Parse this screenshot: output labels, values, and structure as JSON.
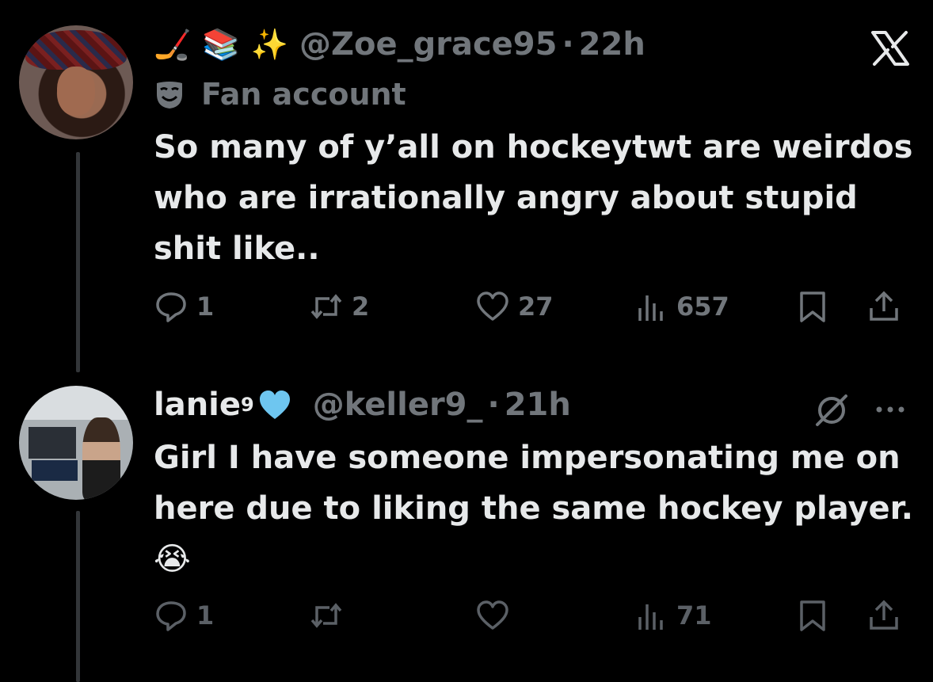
{
  "tweets": [
    {
      "emojis": [
        "🏒",
        "📚",
        "✨"
      ],
      "handle": "@Zoe_grace95",
      "separator": "·",
      "time": "22h",
      "label": "Fan account",
      "text": "So many of y’all on hockeytwt are weirdos who are irrationally angry about stupid shit like..",
      "stats": {
        "replies": "1",
        "reposts": "2",
        "likes": "27",
        "views": "657"
      },
      "avatar_icon": "profile-photo"
    },
    {
      "name": "lanie",
      "name_superscript": "9",
      "name_emoji": "light-blue-heart",
      "handle": "@keller9_",
      "separator": "·",
      "time": "21h",
      "text": "Girl I have someone impersonating me on here due to liking the same hockey player.",
      "text_emoji": "😭",
      "stats": {
        "replies": "1",
        "reposts": "",
        "likes": "",
        "views": "71"
      },
      "avatar_icon": "profile-photo"
    }
  ],
  "colors": {
    "background": "#000000",
    "text": "#e7e9ea",
    "muted": "#71767b",
    "heart_blue": "#6ec6f0"
  },
  "icons": [
    "x-logo-icon",
    "grok-slash-icon",
    "more-icon",
    "reply-icon",
    "repost-icon",
    "like-icon",
    "views-icon",
    "bookmark-icon",
    "share-icon",
    "mask-icon"
  ]
}
